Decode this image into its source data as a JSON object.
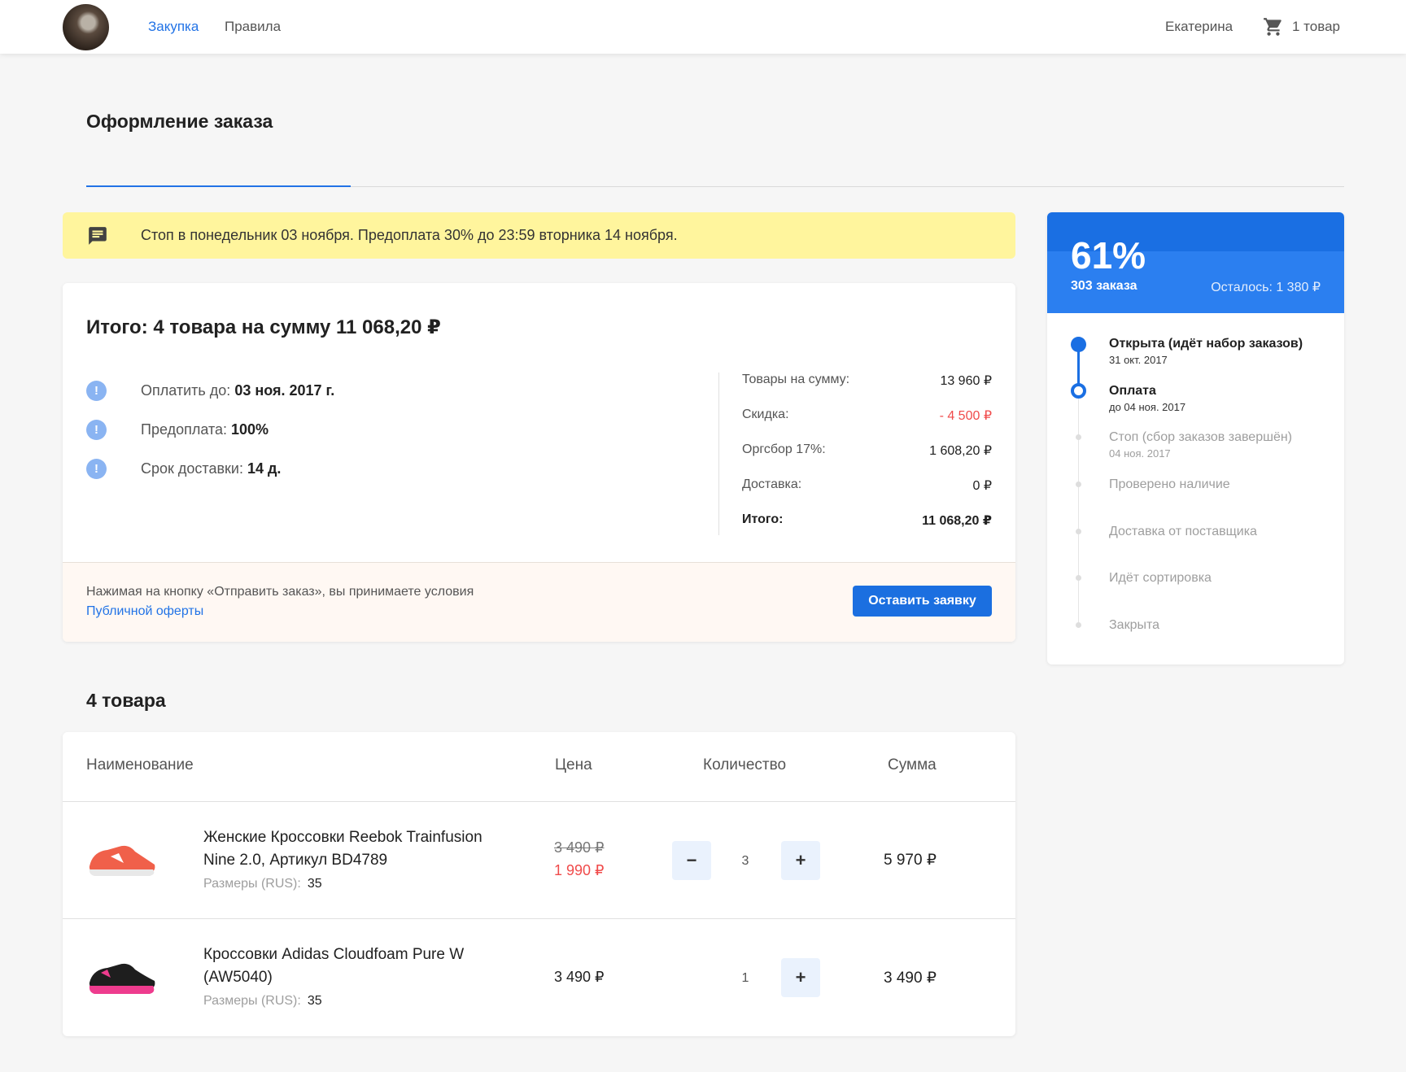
{
  "header": {
    "nav": [
      {
        "label": "Закупка",
        "active": true
      },
      {
        "label": "Правила",
        "active": false
      }
    ],
    "user_name": "Екатерина",
    "cart_icon": "shopping-cart-icon",
    "cart_label": "1 товар"
  },
  "page": {
    "title": "Оформление заказа"
  },
  "notice": {
    "icon": "message-icon",
    "text": "Стоп в понедельник 03 ноября. Предоплата 30% до 23:59 вторника 14 ноября.",
    "color": "#fff59d"
  },
  "summary": {
    "title": "Итого: 4 товара на сумму 11 068,20 ₽",
    "info": [
      {
        "label": "Оплатить до:",
        "value": "03 ноя. 2017 г."
      },
      {
        "label": "Предоплата:",
        "value": "100%"
      },
      {
        "label": "Срок доставки:",
        "value": "14 д."
      }
    ],
    "costs": [
      {
        "label": "Товары на сумму:",
        "value": "13 960 ₽"
      },
      {
        "label": "Скидка:",
        "value": "- 4 500 ₽"
      },
      {
        "label": "Оргсбор 17%:",
        "value": "1 608,20 ₽"
      },
      {
        "label": "Доставка:",
        "value": "0 ₽"
      },
      {
        "label": "Итого:",
        "value": "11 068,20 ₽"
      }
    ],
    "terms_text": "Нажимая на кнопку «Отправить заказ», вы принимаете условия",
    "terms_link": "Публичной оферты",
    "submit_label": "Оставить заявку"
  },
  "progress": {
    "percent": "61%",
    "percent_value": 61,
    "orders": "303 заказа",
    "remaining": "Осталось: 1 380 ₽",
    "accent": "#1a6fe3",
    "steps": [
      {
        "title": "Открыта (идёт набор заказов)",
        "date": "31 окт. 2017",
        "state": "done"
      },
      {
        "title": "Оплата",
        "date": "до 04 ноя. 2017",
        "state": "current"
      },
      {
        "title": "Стоп (сбор заказов завершён)",
        "date": "04 ноя. 2017",
        "state": "future"
      },
      {
        "title": "Проверено наличие",
        "state": "future"
      },
      {
        "title": "Доставка от поставщика",
        "state": "future"
      },
      {
        "title": "Идёт сортировка",
        "state": "future"
      },
      {
        "title": "Закрыта",
        "state": "future"
      }
    ]
  },
  "items": {
    "title": "4 товара",
    "columns": [
      "Наименование",
      "Цена",
      "Количество",
      "Сумма"
    ],
    "size_label": "Размеры (RUS):",
    "rows": [
      {
        "name": "Женские Кроссовки Reebok Trainfusion Nine 2.0, Артикул BD4789",
        "size": "35",
        "old_price": "3 490 ₽",
        "price": "1 990 ₽",
        "quantity": "3",
        "sum": "5 970 ₽",
        "minus": "−",
        "plus": "+"
      },
      {
        "name": "Кроссовки Adidas Cloudfoam Pure W (AW5040)",
        "size": "35",
        "price": "3 490 ₽",
        "quantity": "1",
        "sum": "3 490 ₽",
        "plus": "+"
      }
    ]
  }
}
